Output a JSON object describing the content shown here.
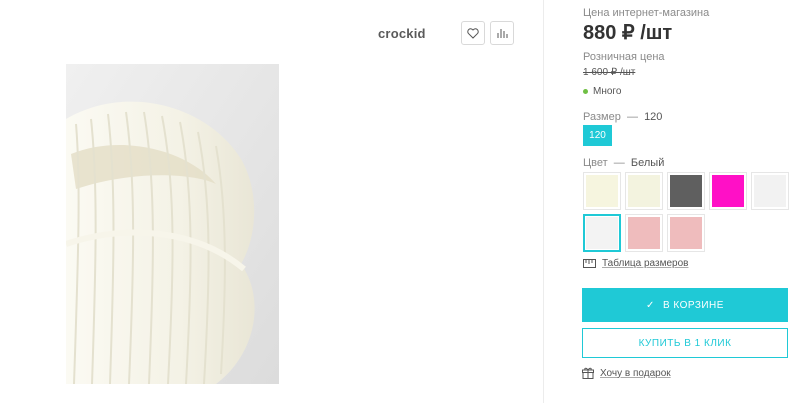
{
  "brand": {
    "name": "crockid"
  },
  "toolbar": {
    "favorite_icon": "heart-icon",
    "compare_icon": "bar-chart-icon"
  },
  "product": {
    "image_alt": "knitted white snood",
    "image_icon": "product-photo"
  },
  "price": {
    "online_label": "Цена интернет-магазина",
    "online_value": "880 ₽ /шт",
    "retail_label": "Розничная цена",
    "retail_value": "1 600 ₽ /шт"
  },
  "stock": {
    "text": "Много",
    "color": "#6fbf44"
  },
  "size": {
    "label": "Размер",
    "separator": "—",
    "selected": "120",
    "options": [
      "120"
    ]
  },
  "color": {
    "label": "Цвет",
    "separator": "—",
    "selected": "Белый",
    "swatches": [
      {
        "color": "#f6f5df"
      },
      {
        "color": "#f3f3df"
      },
      {
        "color": "#5f5f5f"
      },
      {
        "color": "#ff10c6"
      },
      {
        "color": "#f2f2f2"
      },
      {
        "color": "#f3f3f3",
        "selected": true
      },
      {
        "color": "#efbcbd"
      },
      {
        "color": "#efbcbd"
      }
    ]
  },
  "links": {
    "size_table": "Таблица размеров",
    "size_table_icon": "ruler-icon",
    "gift": "Хочу в подарок",
    "gift_icon": "gift-icon"
  },
  "actions": {
    "cart": "В КОРЗИНЕ",
    "cart_icon": "check-icon",
    "one_click": "КУПИТЬ В 1 КЛИК"
  },
  "colors": {
    "accent": "#1fc9d6"
  }
}
